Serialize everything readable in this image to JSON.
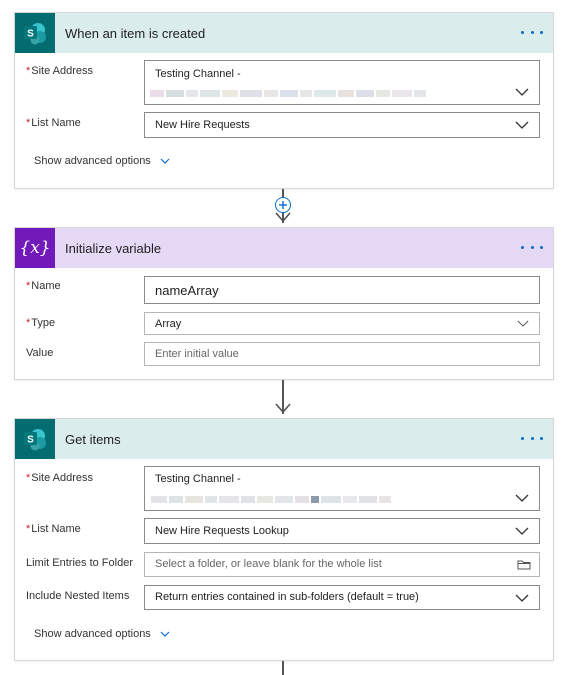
{
  "cards": {
    "trigger": {
      "title": "When an item is created",
      "site_label": "Site Address",
      "site_value": "Testing Channel -",
      "list_label": "List Name",
      "list_value": "New Hire Requests",
      "advanced": "Show advanced options"
    },
    "init_var": {
      "title": "Initialize variable",
      "icon_glyph": "{x}",
      "name_label": "Name",
      "name_value": "nameArray",
      "type_label": "Type",
      "type_value": "Array",
      "value_label": "Value",
      "value_placeholder": "Enter initial value"
    },
    "get_items": {
      "title": "Get items",
      "site_label": "Site Address",
      "site_value": "Testing Channel -",
      "list_label": "List Name",
      "list_value": "New Hire Requests Lookup",
      "folder_label": "Limit Entries to Folder",
      "folder_placeholder": "Select a folder, or leave blank for the whole list",
      "nested_label": "Include Nested Items",
      "nested_value": "Return entries contained in sub-folders (default = true)",
      "advanced": "Show advanced options"
    }
  },
  "required_marker": "*",
  "sharepoint_letter": "S",
  "colors": {
    "sharepoint": "#036c70",
    "sharepoint_header": "#daeceb",
    "variable": "#7219b9",
    "variable_header": "#e6d9f5",
    "accent": "#0a6dcc",
    "required": "#c4262e"
  },
  "icons": [
    "sharepoint-icon",
    "variable-icon",
    "more-options-icon",
    "chevron-down-icon",
    "add-step-icon",
    "folder-icon",
    "arrow-down-icon"
  ]
}
